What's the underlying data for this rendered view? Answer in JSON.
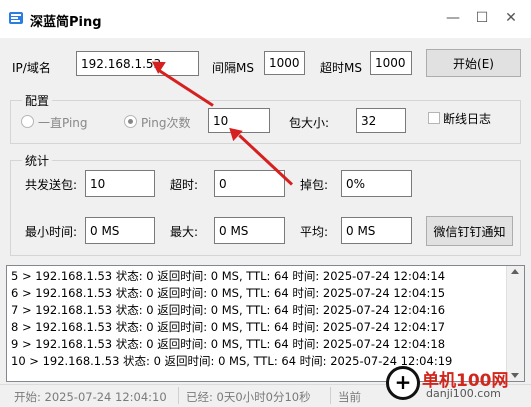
{
  "window": {
    "title": "深蓝简Ping",
    "minimize": "—",
    "maximize": "☐",
    "close": "✕"
  },
  "target": {
    "label": "IP/域名",
    "value": "192.168.1.53"
  },
  "interval": {
    "label": "间隔MS",
    "value": "1000"
  },
  "timeout": {
    "label": "超时MS",
    "value": "1000"
  },
  "start_button": "开始(E)",
  "config": {
    "title": "配置",
    "mode_continuous": "一直Ping",
    "mode_count": "Ping次数",
    "count_value": "10",
    "packet_size_label": "包大小:",
    "packet_size_value": "32",
    "disconnect_log": "断线日志"
  },
  "stats": {
    "title": "统计",
    "sent_label": "共发送包:",
    "sent_value": "10",
    "timeout_label": "超时:",
    "timeout_value": "0",
    "loss_label": "掉包:",
    "loss_value": "0%",
    "min_label": "最小时间:",
    "min_value": "0 MS",
    "max_label": "最大:",
    "max_value": "0 MS",
    "avg_label": "平均:",
    "avg_value": "0 MS",
    "notify_button": "微信钉钉通知"
  },
  "log": [
    "5 > 192.168.1.53 状态: 0 返回时间: 0 MS, TTL: 64 时间: 2025-07-24 12:04:14",
    "6 > 192.168.1.53 状态: 0 返回时间: 0 MS, TTL: 64 时间: 2025-07-24 12:04:15",
    "7 > 192.168.1.53 状态: 0 返回时间: 0 MS, TTL: 64 时间: 2025-07-24 12:04:16",
    "8 > 192.168.1.53 状态: 0 返回时间: 0 MS, TTL: 64 时间: 2025-07-24 12:04:17",
    "9 > 192.168.1.53 状态: 0 返回时间: 0 MS, TTL: 64 时间: 2025-07-24 12:04:18",
    "10 > 192.168.1.53 状态: 0 返回时间: 0 MS, TTL: 64 时间: 2025-07-24 12:04:19"
  ],
  "status": {
    "start": "开始: 2025-07-24 12:04:10",
    "elapsed": "已经: 0天0小时0分10秒",
    "current": "当前"
  },
  "watermark": {
    "icon": "+",
    "text": "单机100网",
    "sub": "danji100.com"
  },
  "colors": {
    "annotation": "#d62020",
    "watermark": "#d0261c"
  }
}
